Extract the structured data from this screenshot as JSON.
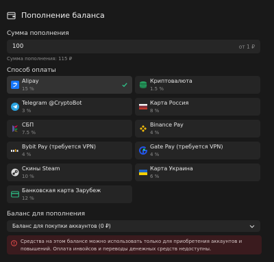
{
  "header": {
    "title": "Пополнение баланса",
    "icon": "wallet-icon"
  },
  "amount": {
    "label": "Сумма пополнения",
    "value": "100",
    "hint": "от 1 ₽",
    "credited": "Сумма пополнения: 115 ₽"
  },
  "payment": {
    "label": "Способ оплаты",
    "methods": [
      {
        "name": "Alipay",
        "fee": "15 %",
        "icon": "alipay-icon",
        "selected": true
      },
      {
        "name": "Криптовалюта",
        "fee": "1.5 %",
        "icon": "crypto-icon",
        "selected": false
      },
      {
        "name": "Telegram @CryptoBot",
        "fee": "3 %",
        "icon": "telegram-icon",
        "selected": false
      },
      {
        "name": "Карта Россия",
        "fee": "8 %",
        "icon": "russia-flag-icon",
        "selected": false
      },
      {
        "name": "СБП",
        "fee": "7.5 %",
        "icon": "sbp-icon",
        "selected": false
      },
      {
        "name": "Binance Pay",
        "fee": "4 %",
        "icon": "binance-icon",
        "selected": false
      },
      {
        "name": "Bybit Pay (требуется VPN)",
        "fee": "4 %",
        "icon": "bybit-icon",
        "selected": false
      },
      {
        "name": "Gate Pay (требуется VPN)",
        "fee": "4 %",
        "icon": "gate-icon",
        "selected": false
      },
      {
        "name": "Скины Steam",
        "fee": "10 %",
        "icon": "steam-icon",
        "selected": false
      },
      {
        "name": "Карта Украина",
        "fee": "6 %",
        "icon": "ukraine-flag-icon",
        "selected": false
      },
      {
        "name": "Банковская карта Зарубеж",
        "fee": "12 %",
        "icon": "bank-card-icon",
        "selected": false
      }
    ]
  },
  "balance": {
    "label": "Баланс для пополнения",
    "value": "Баланс для покупки аккаунтов (0 ₽)"
  },
  "alert": {
    "text": "Средства на этом балансе можно использовать только для приобретения аккаунтов и повышений. Оплата инвойсов и переводы денежных средств недоступны."
  },
  "colors": {
    "background": "#191919",
    "card": "#252525",
    "card_selected": "#333333",
    "check": "#2fbf87",
    "alert_bg": "#3a1b1e",
    "alert_icon": "#e24a4a"
  }
}
